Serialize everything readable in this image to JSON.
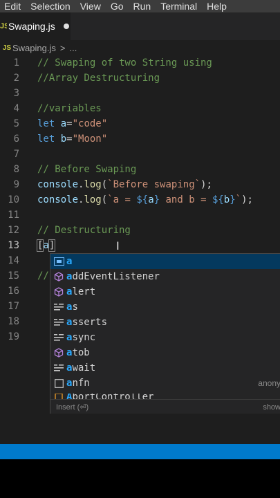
{
  "menubar": [
    "Edit",
    "Selection",
    "View",
    "Go",
    "Run",
    "Terminal",
    "Help"
  ],
  "tab": {
    "js_mark": "JS",
    "label": "Swaping.js"
  },
  "breadcrumb": {
    "js_mark": "JS",
    "file": "Swaping.js",
    "sep": ">",
    "more": "..."
  },
  "lines": [
    {
      "n": "1",
      "tokens": [
        [
          "comment",
          "// Swaping of two String using"
        ]
      ]
    },
    {
      "n": "2",
      "tokens": [
        [
          "comment",
          "//Array Destructuring"
        ]
      ]
    },
    {
      "n": "3",
      "tokens": []
    },
    {
      "n": "4",
      "tokens": [
        [
          "comment",
          "//variables"
        ]
      ]
    },
    {
      "n": "5",
      "tokens": [
        [
          "kw",
          "let "
        ],
        [
          "var",
          "a"
        ],
        [
          "op",
          "="
        ],
        [
          "str",
          "\"code\""
        ]
      ]
    },
    {
      "n": "6",
      "tokens": [
        [
          "kw",
          "let "
        ],
        [
          "var",
          "b"
        ],
        [
          "op",
          "="
        ],
        [
          "str",
          "\"Moon\""
        ]
      ]
    },
    {
      "n": "7",
      "tokens": []
    },
    {
      "n": "8",
      "tokens": [
        [
          "comment",
          "// Before Swaping"
        ]
      ]
    },
    {
      "n": "9",
      "tokens": [
        [
          "var",
          "console"
        ],
        [
          "op",
          "."
        ],
        [
          "fn",
          "log"
        ],
        [
          "op",
          "("
        ],
        [
          "str",
          "`Before swaping`"
        ],
        [
          "op",
          ");"
        ]
      ]
    },
    {
      "n": "10",
      "tokens": [
        [
          "var",
          "console"
        ],
        [
          "op",
          "."
        ],
        [
          "fn",
          "log"
        ],
        [
          "op",
          "("
        ],
        [
          "str",
          "`a = "
        ],
        [
          "tmpl-var",
          "${"
        ],
        [
          "var",
          "a"
        ],
        [
          "tmpl-var",
          "}"
        ],
        [
          "str",
          " and b = "
        ],
        [
          "tmpl-var",
          "${"
        ],
        [
          "var",
          "b"
        ],
        [
          "tmpl-var",
          "}"
        ],
        [
          "str",
          "`"
        ],
        [
          "op",
          ");"
        ]
      ]
    },
    {
      "n": "11",
      "tokens": []
    },
    {
      "n": "12",
      "tokens": [
        [
          "comment",
          "// Destructuring"
        ]
      ]
    },
    {
      "n": "13",
      "tokens": [
        [
          "bracket-box op",
          "["
        ],
        [
          "var",
          "a"
        ],
        [
          "bracket-box op",
          "]"
        ]
      ],
      "active": true
    },
    {
      "n": "14",
      "tokens": []
    },
    {
      "n": "15",
      "tokens": [
        [
          "comment",
          "// "
        ]
      ]
    },
    {
      "n": "16",
      "tokens": []
    },
    {
      "n": "17",
      "tokens": []
    },
    {
      "n": "18",
      "tokens": []
    },
    {
      "n": "19",
      "tokens": []
    }
  ],
  "cursor_glyph": "I",
  "suggestions": [
    {
      "icon": "variable-icon",
      "hl": "a",
      "rest": "",
      "detail": "",
      "selected": true
    },
    {
      "icon": "method-cube-icon",
      "hl": "a",
      "rest": "ddEventListener",
      "detail": ""
    },
    {
      "icon": "method-cube-icon",
      "hl": "a",
      "rest": "lert",
      "detail": ""
    },
    {
      "icon": "keyword-icon",
      "hl": "a",
      "rest": "s",
      "detail": ""
    },
    {
      "icon": "keyword-icon",
      "hl": "a",
      "rest": "sserts",
      "detail": ""
    },
    {
      "icon": "keyword-icon",
      "hl": "a",
      "rest": "sync",
      "detail": ""
    },
    {
      "icon": "method-cube-icon",
      "hl": "a",
      "rest": "tob",
      "detail": ""
    },
    {
      "icon": "keyword-icon",
      "hl": "a",
      "rest": "wait",
      "detail": ""
    },
    {
      "icon": "snippet-icon",
      "hl": "a",
      "rest": "nfn",
      "detail": "anony"
    }
  ],
  "suggestion_cut": {
    "hl": "A",
    "rest": "bortController"
  },
  "suggest_footer": {
    "left": "Insert (⏎)",
    "right": "show"
  }
}
